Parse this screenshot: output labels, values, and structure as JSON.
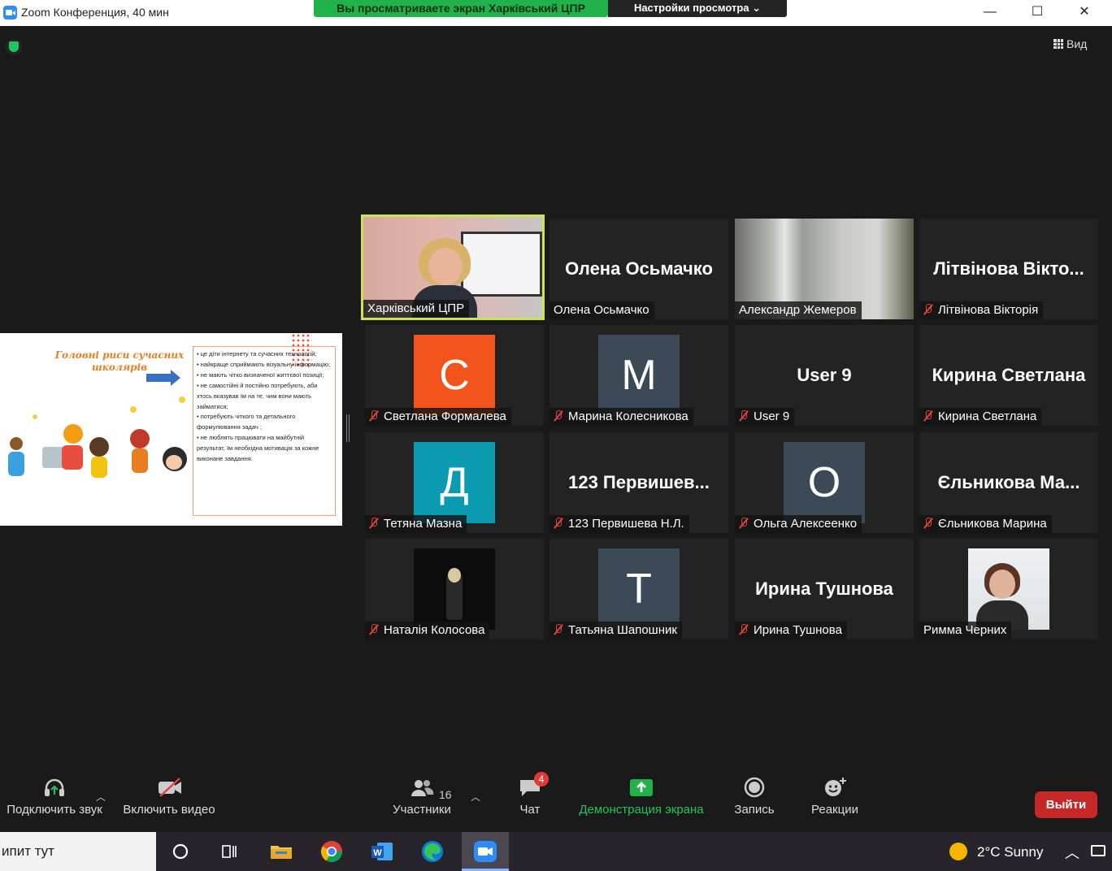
{
  "window": {
    "title": "Zoom Конференция, 40 мин",
    "share_banner": "Вы просматриваете экран Харківський ЦПР",
    "view_options": "Настройки просмотра ⌄",
    "minimize": "—",
    "maximize": "☐",
    "close": "✕"
  },
  "meeting": {
    "view_label": "Вид"
  },
  "slide": {
    "title": "Головні риси сучасних школярів",
    "bullets": "• це діти інтернету та сучасних технологій;\n• найкраще сприймають візуальну інформацію;\n• не мають чітко визначеної життєвої позиції;\n• не самостійні й постійно потребують, аби хтось вказував їм на те, чим вони мають займатися;\n• потребують чіткого та детального формулювання задач ;\n• не люблять працювати на майбутній результат, їм необхідна мотивація за кожне виконане завдання."
  },
  "participants": [
    {
      "label": "Харківський ЦПР",
      "muted": false,
      "type": "video"
    },
    {
      "label": "Олена Осьмачко",
      "muted": false,
      "type": "name",
      "display": "Олена Осьмачко"
    },
    {
      "label": "Александр Жемеров",
      "muted": false,
      "type": "video"
    },
    {
      "label": "Літвінова Вікторія",
      "muted": true,
      "type": "name",
      "display": "Літвінова Вікто..."
    },
    {
      "label": "Светлана Формалева",
      "muted": true,
      "type": "avatar",
      "letter": "С",
      "color": "#f2541b"
    },
    {
      "label": "Марина Колесникова",
      "muted": true,
      "type": "avatar",
      "letter": "М",
      "color": "#3c4a58"
    },
    {
      "label": "User 9",
      "muted": true,
      "type": "name",
      "display": "User 9"
    },
    {
      "label": "Кирина Светлана",
      "muted": true,
      "type": "name",
      "display": "Кирина Светлана"
    },
    {
      "label": "Тетяна Мазна",
      "muted": true,
      "type": "avatar",
      "letter": "Д",
      "color": "#0b9bb0"
    },
    {
      "label": "123 Первишева Н.Л.",
      "muted": true,
      "type": "name",
      "display": "123  Первишев..."
    },
    {
      "label": "Ольга Алексеенко",
      "muted": true,
      "type": "avatar",
      "letter": "О",
      "color": "#3c4a58"
    },
    {
      "label": "Єльникова Марина",
      "muted": true,
      "type": "name",
      "display": "Єльникова  Ма..."
    },
    {
      "label": "Наталія Колосова",
      "muted": true,
      "type": "video"
    },
    {
      "label": "Татьяна Шапошник",
      "muted": true,
      "type": "avatar",
      "letter": "Т",
      "color": "#3c4a58"
    },
    {
      "label": "Ирина Тушнова",
      "muted": true,
      "type": "name",
      "display": "Ирина Тушнова"
    },
    {
      "label": "Римма Черних",
      "muted": false,
      "type": "video"
    }
  ],
  "toolbar": {
    "audio": "Подключить звук",
    "video": "Включить видео",
    "participants": "Участники",
    "participants_count": "16",
    "chat": "Чат",
    "chat_badge": "4",
    "share": "Демонстрация экрана",
    "record": "Запись",
    "reactions": "Реакции",
    "leave": "Выйти"
  },
  "taskbar": {
    "search_text": "ипит тут",
    "weather": "2°C  Sunny"
  },
  "colors": {
    "share_green": "#22b24c",
    "active_speaker": "#c8e653",
    "leave_red": "#c62828",
    "muted_red": "#e0453a"
  }
}
